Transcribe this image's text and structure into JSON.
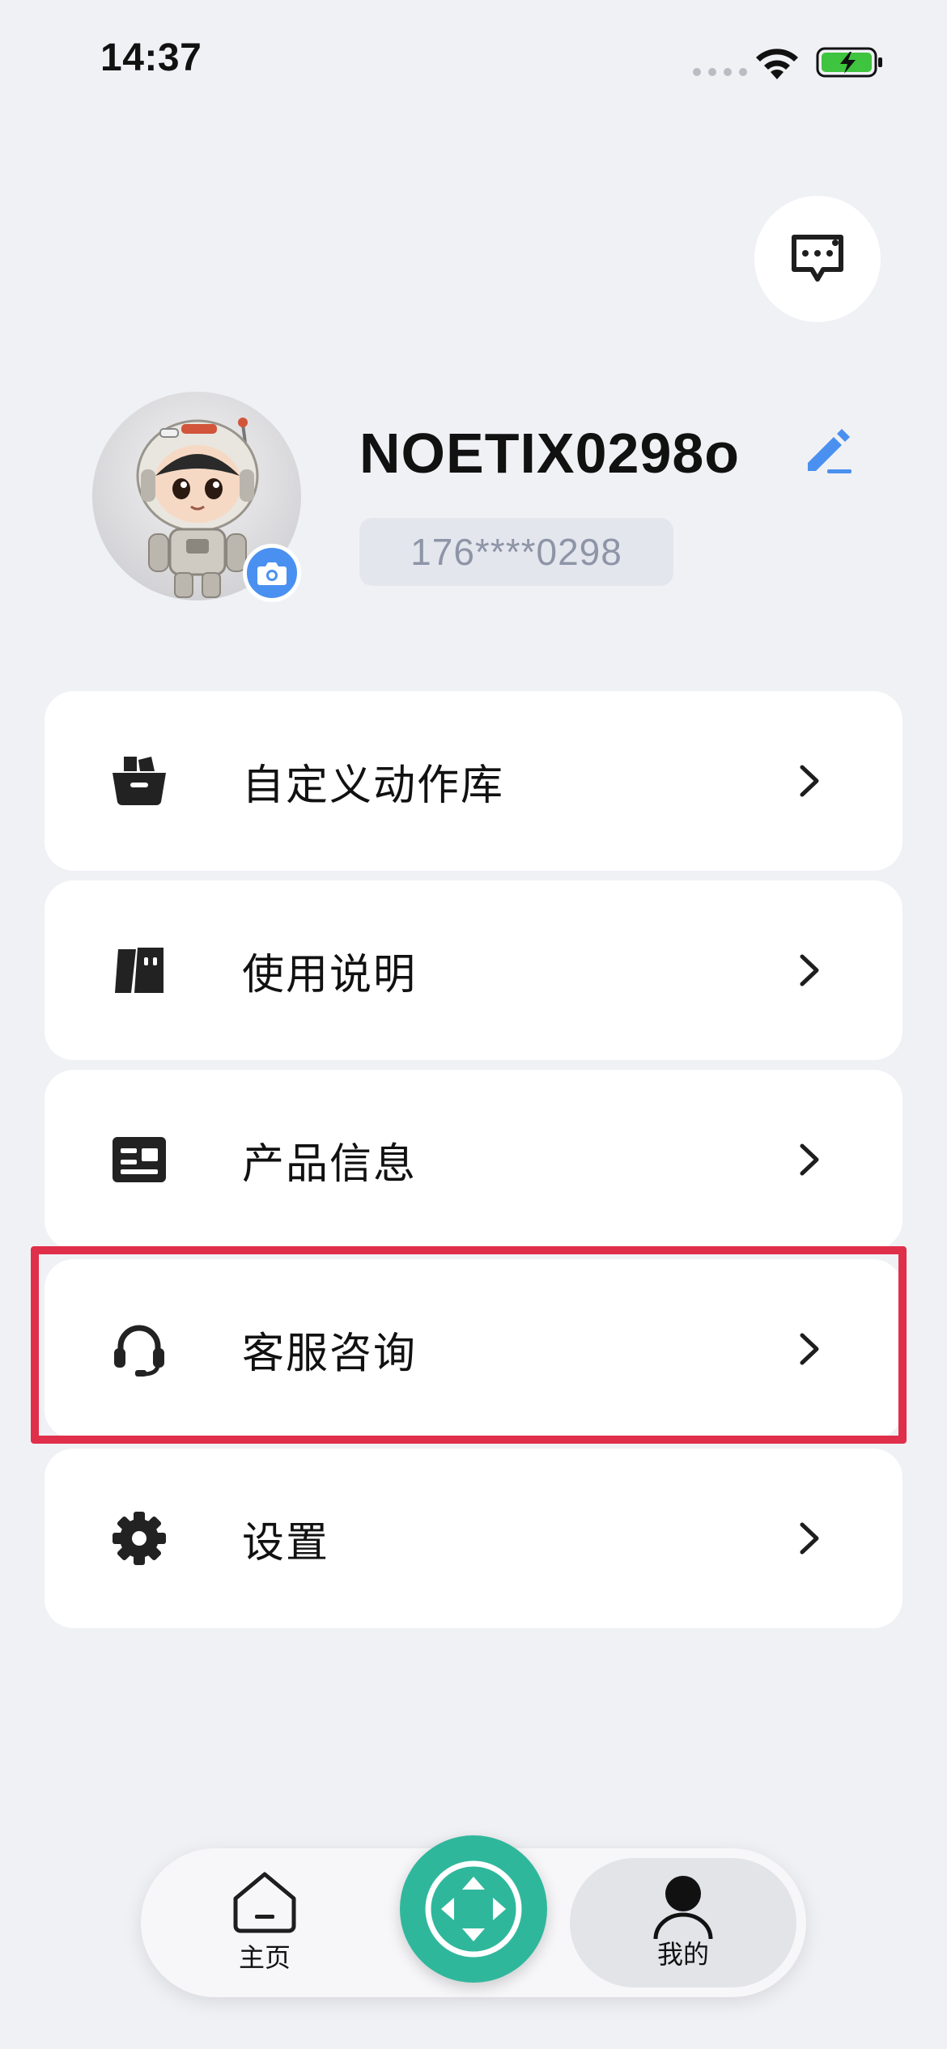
{
  "status_bar": {
    "time": "14:37"
  },
  "profile": {
    "username": "NOETIX0298o",
    "phone": "176****0298"
  },
  "menu": {
    "items": [
      {
        "label": "自定义动作库",
        "icon": "bag-icon"
      },
      {
        "label": "使用说明",
        "icon": "book-icon"
      },
      {
        "label": "产品信息",
        "icon": "id-card-icon"
      },
      {
        "label": "客服咨询",
        "icon": "headset-icon"
      },
      {
        "label": "设置",
        "icon": "gear-icon"
      }
    ]
  },
  "tabbar": {
    "home_label": "主页",
    "mine_label": "我的",
    "active": "我的"
  },
  "colors": {
    "background": "#f0f1f5",
    "accent_blue": "#4a90f0",
    "fab_green": "#2fb79c",
    "highlight_red": "#e02f4a"
  }
}
